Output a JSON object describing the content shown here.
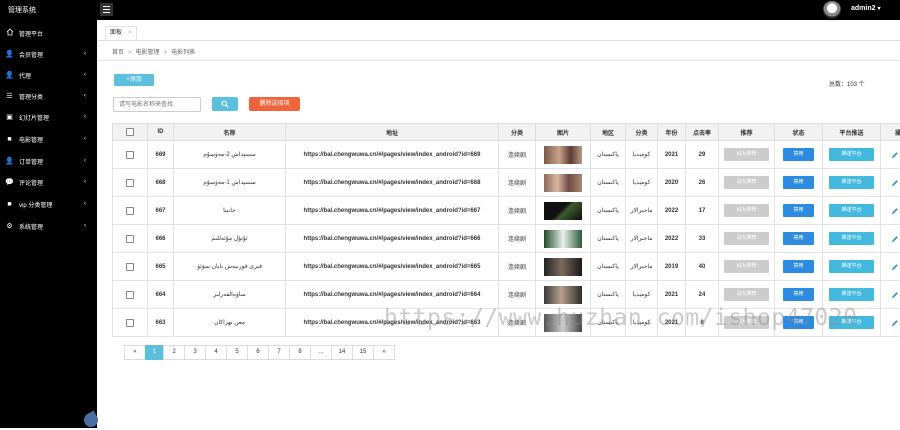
{
  "app": {
    "title": "管理系统"
  },
  "user": {
    "name": "admin2"
  },
  "sidebar": {
    "items": [
      {
        "label": "管理平台",
        "icon": "home-icon",
        "arrow": false
      },
      {
        "label": "会员管理",
        "icon": "user-icon",
        "arrow": true
      },
      {
        "label": "代理",
        "icon": "user-icon",
        "arrow": true
      },
      {
        "label": "管理分类",
        "icon": "list-icon",
        "arrow": true
      },
      {
        "label": "幻灯片管理",
        "icon": "image-icon",
        "arrow": true
      },
      {
        "label": "电影管理",
        "icon": "video-icon",
        "arrow": true
      },
      {
        "label": "订单管理",
        "icon": "user-icon",
        "arrow": true
      },
      {
        "label": "评论管理",
        "icon": "comment-icon",
        "arrow": true
      },
      {
        "label": "vip 分类管理",
        "icon": "video-icon",
        "arrow": true
      },
      {
        "label": "系统管理",
        "icon": "gear-icon",
        "arrow": true
      }
    ]
  },
  "tabs": [
    {
      "label": "面板",
      "close": "×"
    }
  ],
  "breadcrumb": [
    "首页",
    "电影管理",
    "电影列表"
  ],
  "breadcrumb_sep": ">",
  "toolbar": {
    "add_label": "+添加",
    "total_label": "总数：103 个",
    "search_placeholder": "请写电影名称来查找",
    "delete_selected_label": "删除选择项"
  },
  "table": {
    "headers": [
      "",
      "ID",
      "名称",
      "地址",
      "分类",
      "图片",
      "地区",
      "分类",
      "年份",
      "点击率",
      "推荐",
      "状态",
      "平台推送",
      "操作"
    ],
    "rows": [
      {
        "id": "669",
        "name": "سىنىپداش 2-مەۋسۇم",
        "url": "https://bal.chengwuwa.cn/#/pages/view/index_android?id=669",
        "category": "连续剧",
        "region": "پاكىستان",
        "genre": "كومېديا",
        "year": "2021",
        "clicks": "29",
        "recommend": "设为推荐",
        "status": "禁用",
        "push": "推送平台"
      },
      {
        "id": "668",
        "name": "سىنىپداش 1-مەۋسۇم",
        "url": "https://bal.chengwuwa.cn/#/pages/view/index_android?id=668",
        "category": "连续剧",
        "region": "پاكىستان",
        "genre": "كومېديا",
        "year": "2020",
        "clicks": "26",
        "recommend": "设为推荐",
        "status": "禁用",
        "push": "推送平台"
      },
      {
        "id": "667",
        "name": "جانىنا",
        "url": "https://bal.chengwuwa.cn/#/pages/view/index_android?id=667",
        "category": "连续剧",
        "region": "پاكىستان",
        "genre": "ماجىرالار",
        "year": "2022",
        "clicks": "17",
        "recommend": "设为推荐",
        "status": "禁用",
        "push": "推送平台"
      },
      {
        "id": "666",
        "name": "ئۇتۇل مۇئەللىم",
        "url": "https://bal.chengwuwa.cn/#/pages/view/index_android?id=666",
        "category": "连续剧",
        "region": "پاكىستان",
        "genre": "ماجىرالار",
        "year": "2022",
        "clicks": "33",
        "recommend": "设为推荐",
        "status": "禁用",
        "push": "推送平台"
      },
      {
        "id": "665",
        "name": "قىزى قورىيەش بايان سۆئۈ",
        "url": "https://bal.chengwuwa.cn/#/pages/view/index_android?id=665",
        "category": "连续剧",
        "region": "پاكىستان",
        "genre": "ماجىرالار",
        "year": "2019",
        "clicks": "40",
        "recommend": "设为推荐",
        "status": "禁用",
        "push": "推送平台"
      },
      {
        "id": "664",
        "name": "ساۋەالقەرلىر",
        "url": "https://bal.chengwuwa.cn/#/pages/view/index_android?id=664",
        "category": "连续剧",
        "region": "پاكىستان",
        "genre": "كومېديا",
        "year": "2021",
        "clicks": "24",
        "recommend": "设为推荐",
        "status": "禁用",
        "push": "推送平台"
      },
      {
        "id": "663",
        "name": "معن نهزاكان",
        "url": "https://bal.chengwuwa.cn/#/pages/view/index_android?id=663",
        "category": "连续剧",
        "region": "پاكىستان",
        "genre": "كومېديا",
        "year": "2021",
        "clicks": "8",
        "recommend": "设为推荐",
        "status": "禁用",
        "push": "推送平台"
      }
    ]
  },
  "pagination": [
    "«",
    "1",
    "2",
    "3",
    "4",
    "5",
    "6",
    "7",
    "8",
    "...",
    "14",
    "15",
    "»"
  ],
  "pagination_active": "1",
  "watermark": "https://www.huzhan.com/ishop47020",
  "colors": {
    "accent": "#5bc0de",
    "danger": "#f0643d",
    "status": "#2d8ce0",
    "push": "#44b9e0",
    "sidebar": "#000000"
  }
}
